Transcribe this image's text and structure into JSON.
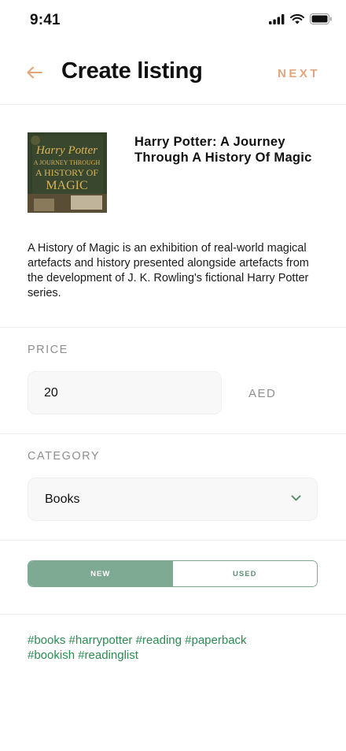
{
  "status_bar": {
    "time": "9:41"
  },
  "header": {
    "title": "Create listing",
    "next_label": "NEXT"
  },
  "colors": {
    "accent": "#e3a47a",
    "brand_green": "#7ea992",
    "tag_green": "#2c8a52"
  },
  "book": {
    "title": "Harry Potter: A Journey Through A History Of Magic",
    "description": "A History of Magic is an exhibition of real-world magical artefacts and history presented alongside artefacts from the development of J. K. Rowling's fictional Harry Potter series.",
    "cover_text": {
      "line1": "Harry Potter",
      "line2": "A JOURNEY THROUGH",
      "line3": "A HISTORY OF",
      "line4": "MAGIC"
    }
  },
  "price": {
    "label": "PRICE",
    "value": "20",
    "currency": "AED"
  },
  "category": {
    "label": "CATEGORY",
    "value": "Books"
  },
  "condition": {
    "options": [
      "NEW",
      "USED"
    ],
    "selected": "NEW"
  },
  "tags": [
    "#books",
    "#harrypotter",
    "#reading",
    "#paperback",
    "#bookish",
    "#readinglist"
  ]
}
